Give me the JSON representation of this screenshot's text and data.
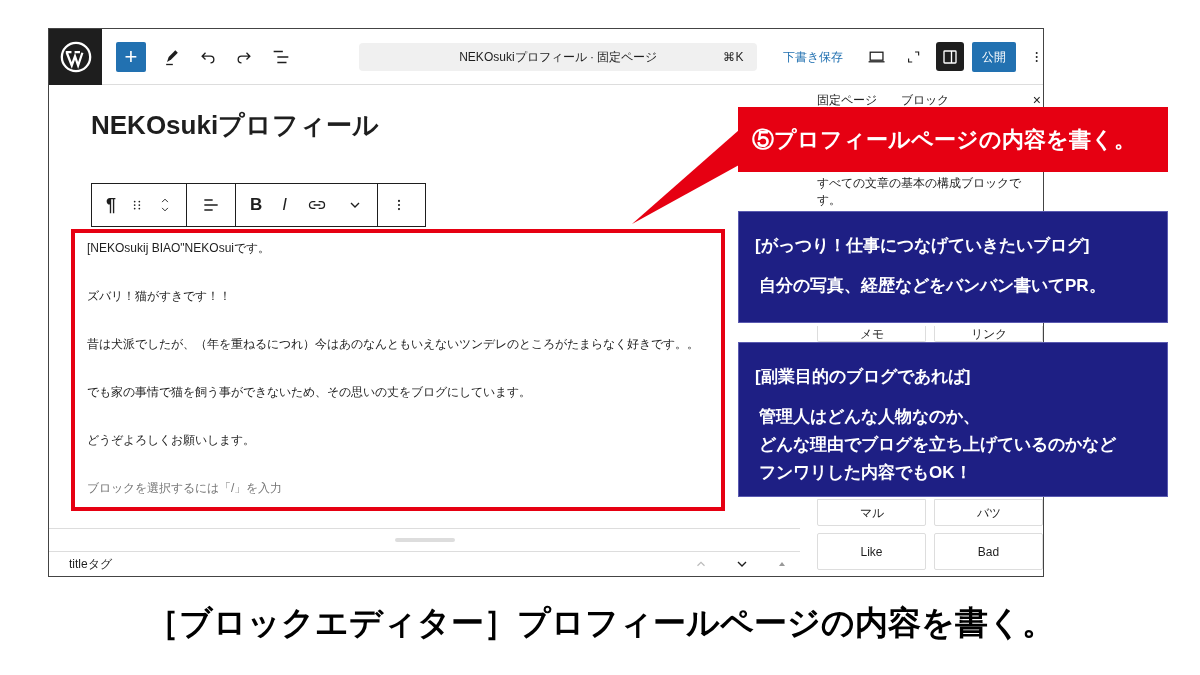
{
  "header": {
    "add_button": "+",
    "command_bar": {
      "title": "NEKOsukiプロフィール · 固定ページ",
      "shortcut": "⌘K"
    },
    "save_draft": "下書き保存",
    "settings_toggle": {
      "pressed": true
    },
    "publish": "公開"
  },
  "editor": {
    "title": "NEKOsukiプロフィール",
    "toolbar": {
      "paragraph": "¶",
      "bold": "B",
      "italic": "I"
    },
    "paragraphs": [
      "[NEKOsukij BIAO\"NEKOsuiです。",
      "ズバリ！猫がすきです！！",
      "昔は犬派でしたが、（年を重ねるにつれ）今はあのなんともいえないツンデレのところがたまらなく好きです。。",
      "でも家の事情で猫を飼う事ができないため、その思いの丈をブログにしています。",
      "どうぞよろしくお願いします。"
    ],
    "placeholder": "ブロックを選択するには「/」を入力",
    "bottom_panel": {
      "title": "titleタグ"
    }
  },
  "sidebar": {
    "tabs": [
      "固定ページ",
      "ブロック"
    ],
    "close": "×",
    "description": "すべての文章の基本の構成ブロックです。",
    "block_rows": [
      [
        "メモ",
        "リンク"
      ],
      [
        "マル",
        "バツ"
      ],
      [
        "Like",
        "Bad"
      ]
    ]
  },
  "callouts": [
    {
      "kind": "red",
      "text": "⑤プロフィールページの内容を書く。"
    },
    {
      "kind": "blue",
      "heading": "[がっつり！仕事につなげていきたいブログ]",
      "lines": [
        "自分の写真、経歴などをバンバン書いてPR。"
      ]
    },
    {
      "kind": "blue",
      "heading": "[副業目的のブログであれば]",
      "lines": [
        "管理人はどんな人物なのか、",
        "どんな理由でブログを立ち上げているのかなど",
        "フンワリした内容でもOK！"
      ]
    }
  ],
  "caption": "［ブロックエディター］プロフィールページの内容を書く。"
}
